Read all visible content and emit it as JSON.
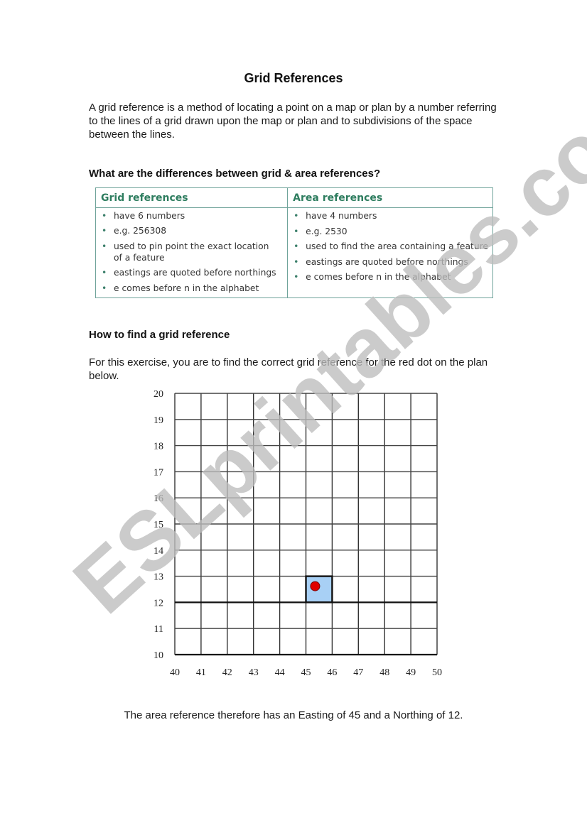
{
  "document": {
    "title": "Grid References",
    "intro": "A grid reference is a method of locating a point on a map or plan by a number referring to the lines of a grid drawn upon the map or plan and to subdivisions of the space between the lines.",
    "differences_heading": "What are the differences between grid & area references?",
    "comparison_table": {
      "columns": [
        {
          "header": "Grid references",
          "items": [
            "have 6 numbers",
            "e.g. 256308",
            "used to pin point the exact location of a feature",
            "eastings are quoted before northings",
            "e comes before n in the alphabet"
          ]
        },
        {
          "header": "Area references",
          "items": [
            "have 4 numbers",
            "e.g. 2530",
            "used to find the area containing a feature",
            "eastings are quoted before northings",
            "e comes before n in the alphabet"
          ]
        }
      ],
      "accent_color": "#2e7d5f",
      "border_color": "#6fa39a"
    },
    "howto_heading": "How to find a grid reference",
    "exercise_text": "For this exercise, you are to find the correct grid reference for the red dot on the plan below.",
    "conclusion": "The area reference therefore has an Easting of 45 and a Northing of 12.",
    "watermark": "ESLprintables.com"
  },
  "grid_plan": {
    "eastings": [
      40,
      41,
      42,
      43,
      44,
      45,
      46,
      47,
      48,
      49,
      50
    ],
    "northings": [
      10,
      11,
      12,
      13,
      14,
      15,
      16,
      17,
      18,
      19,
      20
    ],
    "bold_northings": [
      10,
      12
    ],
    "highlighted_square": {
      "easting": 45,
      "northing": 12,
      "fill": "#a8d0f5"
    },
    "red_dot": {
      "easting": 45.35,
      "northing": 12.62,
      "color": "#e00000"
    }
  }
}
